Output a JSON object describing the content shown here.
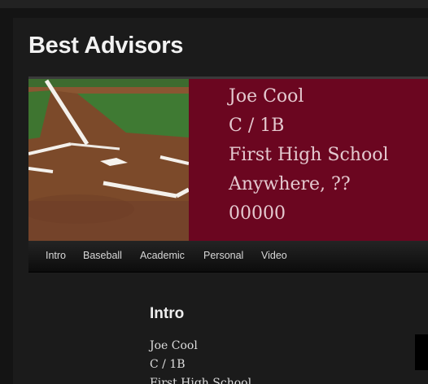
{
  "site": {
    "title": "Best Advisors"
  },
  "banner": {
    "name": "Joe Cool",
    "position": "C / 1B",
    "school": "First High School",
    "location": "Anywhere, ??",
    "zip": "00000"
  },
  "nav": {
    "items": [
      {
        "label": "Intro"
      },
      {
        "label": "Baseball"
      },
      {
        "label": "Academic"
      },
      {
        "label": "Personal"
      },
      {
        "label": "Video"
      }
    ]
  },
  "content": {
    "heading": "Intro",
    "lines": [
      "Joe Cool",
      "C / 1B",
      "First High School"
    ]
  },
  "colors": {
    "banner_bg": "#6b0620",
    "banner_text": "#e4c9cf",
    "page_bg": "#141414"
  }
}
